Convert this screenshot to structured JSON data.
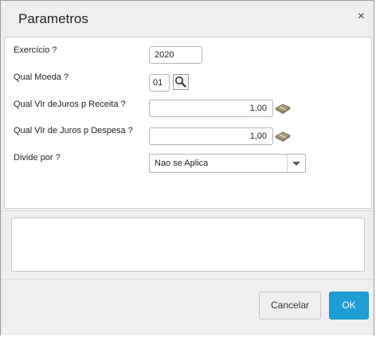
{
  "dialog": {
    "title": "Parametros",
    "close_glyph": "×"
  },
  "form": {
    "fields": [
      {
        "label": "Exercício ?",
        "value": "2020"
      },
      {
        "label": "Qual Moeda ?",
        "value": "01",
        "icon": "search-icon"
      },
      {
        "label": "Qual Vlr deJuros p Receita ?",
        "value": "1,00",
        "icon": "calculator-icon"
      },
      {
        "label": "Qual Vlr de Juros p Despesa ?",
        "value": "1,00",
        "icon": "calculator-icon"
      },
      {
        "label": "Divide por ?",
        "value": "Nao se Aplica",
        "icon": "chevron-down-icon"
      }
    ]
  },
  "memo": {
    "value": ""
  },
  "footer": {
    "cancel_label": "Cancelar",
    "ok_label": "OK"
  },
  "colors": {
    "ok_button": "#1d9fd6",
    "background": "#efefef"
  }
}
